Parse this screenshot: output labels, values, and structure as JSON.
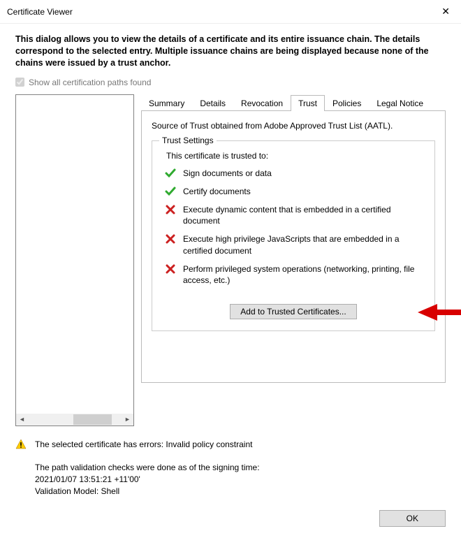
{
  "window": {
    "title": "Certificate Viewer"
  },
  "intro": "This dialog allows you to view the details of a certificate and its entire issuance chain. The details correspond to the selected entry. Multiple issuance chains are being displayed because none of the chains were issued by a trust anchor.",
  "checkbox": {
    "label": "Show all certification paths found"
  },
  "tabs": {
    "summary": "Summary",
    "details": "Details",
    "revocation": "Revocation",
    "trust": "Trust",
    "policies": "Policies",
    "legal": "Legal Notice"
  },
  "trust": {
    "source": "Source of Trust obtained from Adobe Approved Trust List (AATL).",
    "settings_legend": "Trust Settings",
    "trusted_to": "This certificate is trusted to:",
    "items": [
      {
        "ok": true,
        "text": "Sign documents or data"
      },
      {
        "ok": true,
        "text": "Certify documents"
      },
      {
        "ok": false,
        "text": "Execute dynamic content that is embedded in a certified document"
      },
      {
        "ok": false,
        "text": "Execute high privilege JavaScripts that are embedded in a certified document"
      },
      {
        "ok": false,
        "text": "Perform privileged system operations (networking, printing, file access, etc.)"
      }
    ],
    "add_button": "Add to Trusted Certificates..."
  },
  "status": {
    "error": "The selected certificate has errors: Invalid policy constraint",
    "path_line": "The path validation checks were done as of the signing time:",
    "timestamp": "2021/01/07 13:51:21 +11'00'",
    "model": "Validation Model: Shell"
  },
  "buttons": {
    "ok": "OK"
  }
}
